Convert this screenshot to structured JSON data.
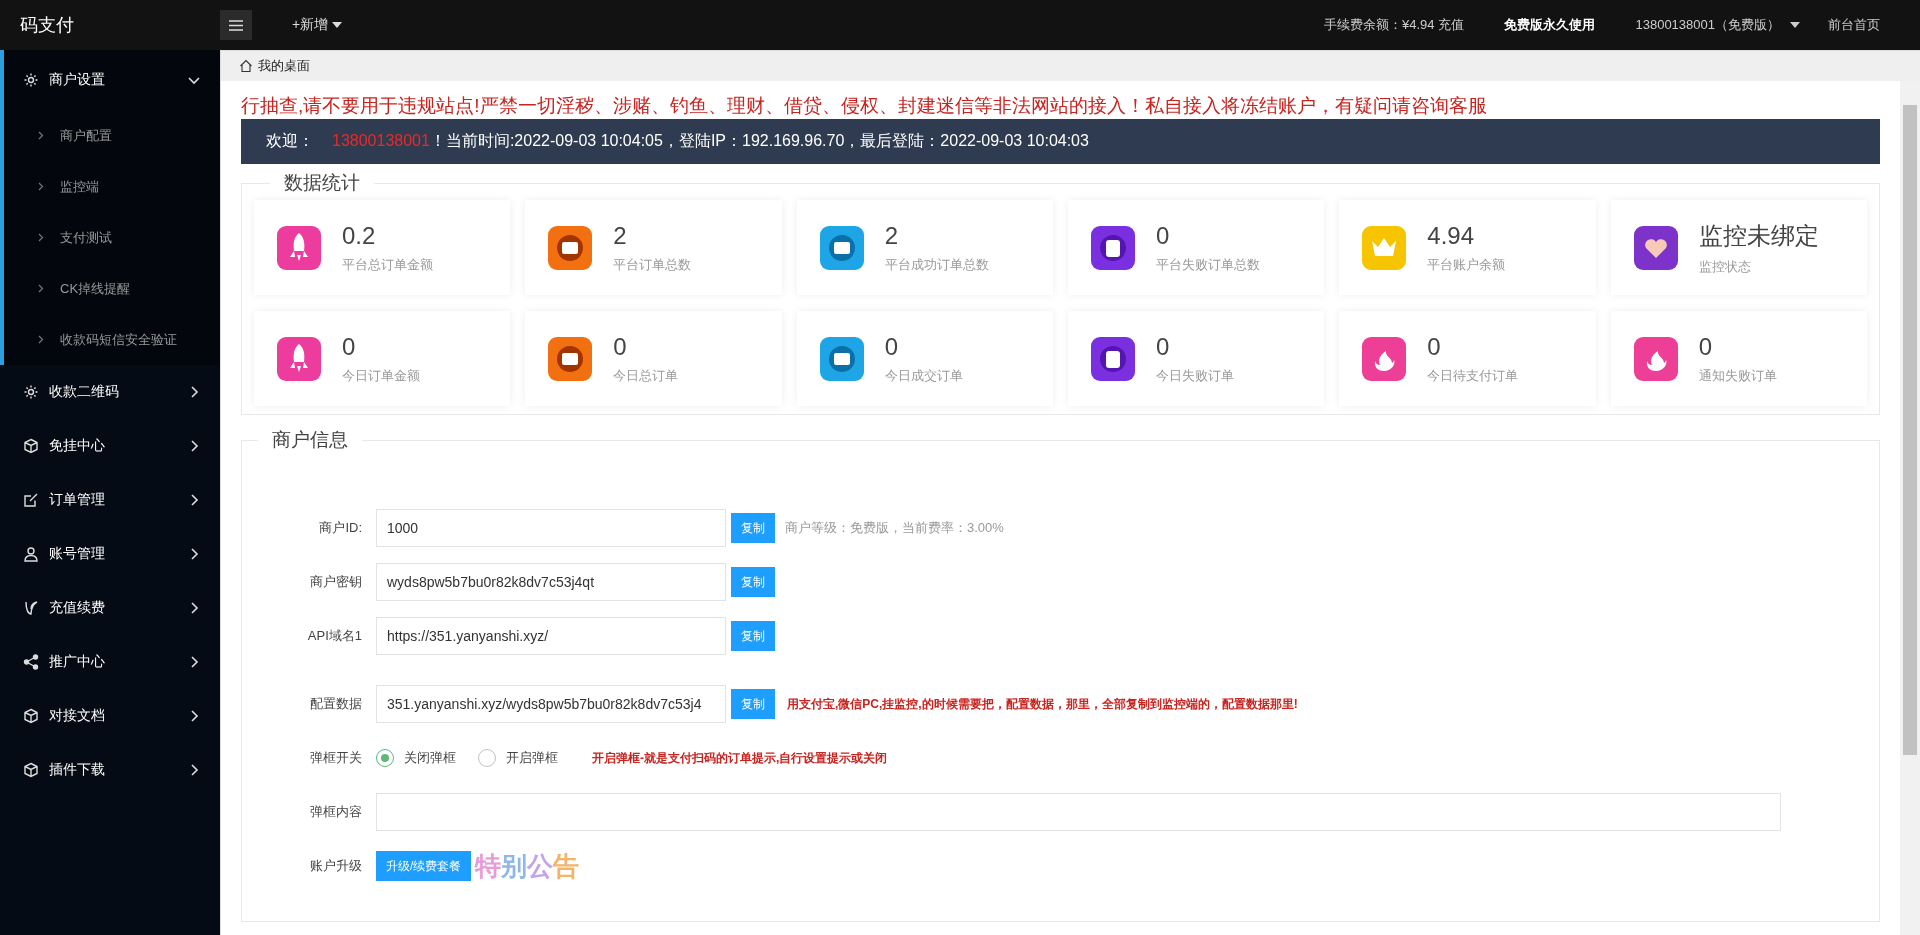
{
  "brand": "码支付",
  "topbar": {
    "new_menu": "+新增",
    "balance": "手续费余额：¥4.94",
    "recharge": "充值",
    "plan": "免费版永久使用",
    "user": "13800138001（免费版）",
    "home": "前台首页"
  },
  "sidebar": {
    "items": [
      {
        "label": "商户设置",
        "kind": "gear",
        "expanded": true,
        "children": [
          {
            "label": "商户配置"
          },
          {
            "label": "监控端"
          },
          {
            "label": "支付测试"
          },
          {
            "label": "CK掉线提醒"
          },
          {
            "label": "收款码短信安全验证"
          }
        ]
      },
      {
        "label": "收款二维码",
        "kind": "gear",
        "expanded": false
      },
      {
        "label": "免挂中心",
        "kind": "cube",
        "expanded": false
      },
      {
        "label": "订单管理",
        "kind": "edit",
        "expanded": false
      },
      {
        "label": "账号管理",
        "kind": "user",
        "expanded": false
      },
      {
        "label": "充值续费",
        "kind": "leaf",
        "expanded": false
      },
      {
        "label": "推广中心",
        "kind": "share",
        "expanded": false
      },
      {
        "label": "对接文档",
        "kind": "cube",
        "expanded": false
      },
      {
        "label": "插件下载",
        "kind": "cube",
        "expanded": false
      }
    ]
  },
  "breadcrumb": "我的桌面",
  "notice": "行抽查,请不要用于违规站点!严禁一切淫秽、涉赌、钓鱼、理财、借贷、侵权、封建迷信等非法网站的接入！私自接入将冻结账户，有疑问请咨询客服",
  "welcome": {
    "label": "欢迎：",
    "user": "13800138001",
    "info": "！当前时间:2022-09-03 10:04:05，登陆IP：192.169.96.70，最后登陆：2022-09-03 10:04:03"
  },
  "stats": {
    "title": "数据统计",
    "cards": [
      {
        "value": "0.2",
        "label": "平台总订单金额",
        "kind": "rocket"
      },
      {
        "value": "2",
        "label": "平台订单总数",
        "kind": "ticket"
      },
      {
        "value": "2",
        "label": "平台成功订单总数",
        "kind": "wallet"
      },
      {
        "value": "0",
        "label": "平台失败订单总数",
        "kind": "cup"
      },
      {
        "value": "4.94",
        "label": "平台账户余额",
        "kind": "crown"
      },
      {
        "value": "监控未绑定",
        "label": "监控状态",
        "kind": "heart"
      },
      {
        "value": "0",
        "label": "今日订单金额",
        "kind": "rocket"
      },
      {
        "value": "0",
        "label": "今日总订单",
        "kind": "ticket"
      },
      {
        "value": "0",
        "label": "今日成交订单",
        "kind": "wallet"
      },
      {
        "value": "0",
        "label": "今日失败订单",
        "kind": "cup"
      },
      {
        "value": "0",
        "label": "今日待支付订单",
        "kind": "flame"
      },
      {
        "value": "0",
        "label": "通知失败订单",
        "kind": "flame"
      }
    ]
  },
  "merchant": {
    "title": "商户信息",
    "rows": [
      {
        "kind": "field",
        "label": "商户ID:",
        "value": "1000",
        "button": "复制",
        "note": "商户等级：免费版，当前费率：3.00%"
      },
      {
        "kind": "field",
        "label": "商户密钥",
        "value": "wyds8pw5b7bu0r82k8dv7c53j4qt",
        "button": "复制"
      },
      {
        "kind": "field",
        "label": "API域名1",
        "value": "https://351.yanyanshi.xyz/",
        "button": "复制"
      },
      {
        "kind": "field",
        "label": "配置数据",
        "value": "351.yanyanshi.xyz/wyds8pw5b7bu0r82k8dv7c53j4",
        "button": "复制",
        "warning": "用支付宝,微信PC,挂监控,的时候需要把，配置数据，那里，全部复制到监控端的，配置数据那里!"
      },
      {
        "kind": "radio",
        "label": "弹框开关",
        "options": [
          {
            "label": "关闭弹框",
            "selected": true
          },
          {
            "label": "开启弹框",
            "selected": false
          }
        ],
        "warning": "开启弹框-就是支付扫码的订单提示,自行设置提示或关闭"
      },
      {
        "kind": "text",
        "label": "弹框内容"
      },
      {
        "kind": "upgrade",
        "label": "账户升级",
        "button": "升级/续费套餐",
        "badge": "特别公告"
      }
    ]
  }
}
